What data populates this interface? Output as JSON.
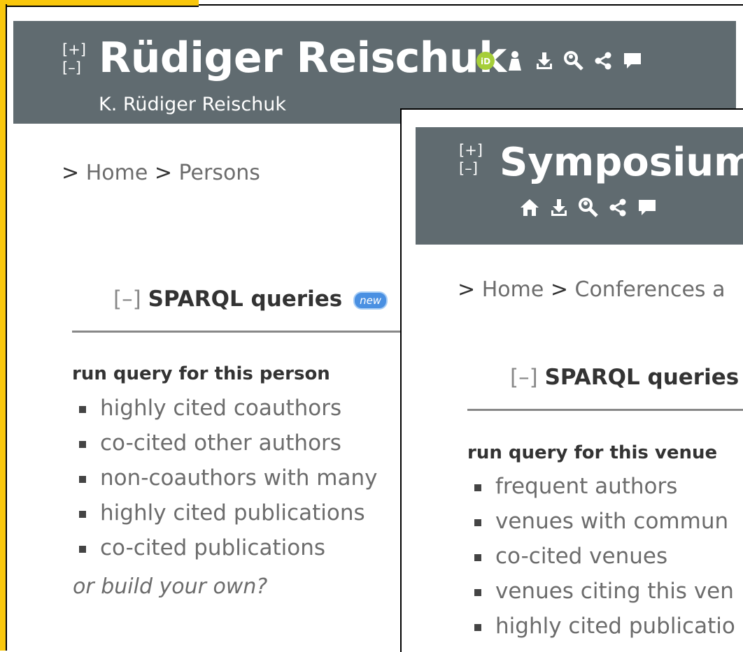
{
  "person": {
    "expand": "[+]",
    "collapse": "[–]",
    "title": "Rüdiger Reischuk",
    "subtitle": "K. Rüdiger Reischuk",
    "breadcrumb": {
      "sep1": "> ",
      "home": "Home",
      "sep2": " > ",
      "section": "Persons"
    },
    "sparql": {
      "toggle": "[–]",
      "heading": "SPARQL queries",
      "badge": "new",
      "run_label": "run query for this person",
      "queries": [
        "highly cited coauthors",
        "co-cited other authors",
        "non-coauthors with many",
        "highly cited publications",
        "co-cited publications"
      ],
      "build_own": "or build your own?"
    }
  },
  "venue": {
    "expand": "[+]",
    "collapse": "[–]",
    "title": "Symposium",
    "breadcrumb": {
      "sep1": "> ",
      "home": "Home",
      "sep2": " > ",
      "section": "Conferences a"
    },
    "sparql": {
      "toggle": "[–]",
      "heading": "SPARQL queries",
      "run_label": "run query for this venue",
      "queries": [
        "frequent authors",
        "venues with commun",
        "co-cited venues",
        "venues citing this ven",
        "highly cited publicatio"
      ]
    }
  },
  "colors": {
    "header_bg": "#606b70",
    "frame": "#f9c70c",
    "link": "#6c6c6c",
    "orcid": "#a6ce39"
  },
  "icons": {
    "person": [
      "orcid-icon",
      "person-icon",
      "download-icon",
      "search-people-icon",
      "share-icon",
      "comment-icon"
    ],
    "venue": [
      "home-icon",
      "download-icon",
      "search-people-icon",
      "share-icon",
      "comment-icon"
    ]
  }
}
